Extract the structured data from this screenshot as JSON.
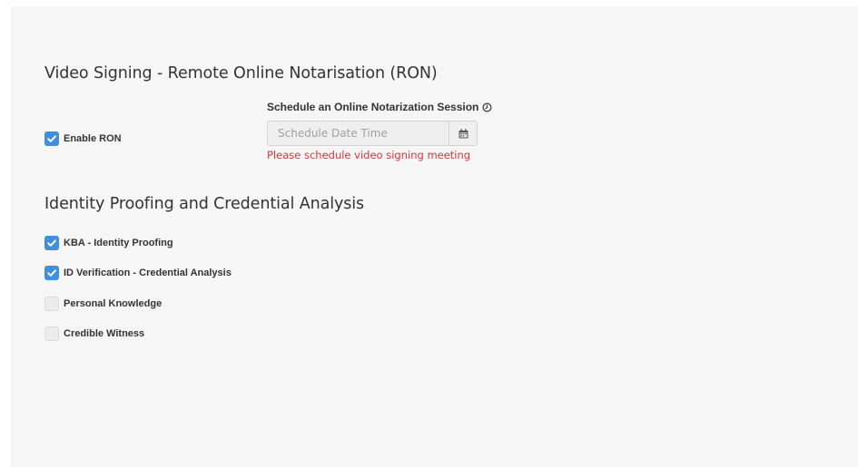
{
  "ron_section": {
    "title": "Video Signing - Remote Online Notarisation (RON)",
    "enable_ron": {
      "label": "Enable RON",
      "checked": true
    },
    "schedule": {
      "label": "Schedule an Online Notarization Session",
      "info_icon": "clock-icon",
      "input_value": "",
      "input_placeholder": "Schedule Date Time",
      "calendar_icon": "calendar-icon",
      "error": "Please schedule video signing meeting"
    }
  },
  "idp_section": {
    "title": "Identity Proofing and Credential Analysis",
    "options": [
      {
        "label": "KBA - Identity Proofing",
        "checked": true
      },
      {
        "label": "ID Verification - Credential Analysis",
        "checked": true
      },
      {
        "label": "Personal Knowledge",
        "checked": false
      },
      {
        "label": "Credible Witness",
        "checked": false
      }
    ]
  },
  "colors": {
    "panel_background": "#f6f6f6",
    "checkbox_checked": "#3f8fdc",
    "error_text": "#d8343a",
    "text": "#333333"
  }
}
